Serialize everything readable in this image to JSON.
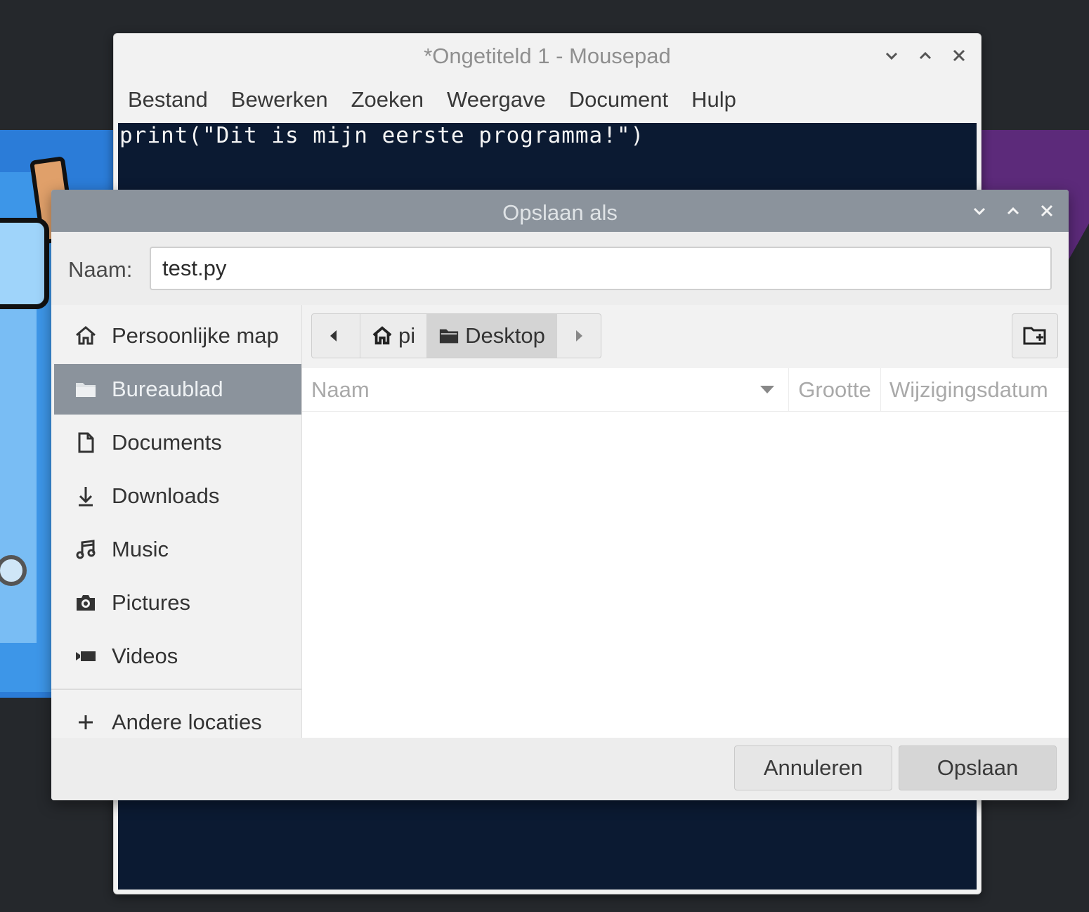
{
  "mousepad": {
    "title": "*Ongetiteld 1 - Mousepad",
    "menu": [
      "Bestand",
      "Bewerken",
      "Zoeken",
      "Weergave",
      "Document",
      "Hulp"
    ],
    "editor_text": "print(\"Dit is mijn eerste programma!\")"
  },
  "dialog": {
    "title": "Opslaan als",
    "name_label": "Naam:",
    "name_value": "test.py",
    "sidebar": [
      {
        "label": "Persoonlijke map",
        "icon": "home-icon"
      },
      {
        "label": "Bureaublad",
        "icon": "folder-icon",
        "active": true
      },
      {
        "label": "Documents",
        "icon": "document-icon"
      },
      {
        "label": "Downloads",
        "icon": "download-icon"
      },
      {
        "label": "Music",
        "icon": "music-icon"
      },
      {
        "label": "Pictures",
        "icon": "camera-icon"
      },
      {
        "label": "Videos",
        "icon": "video-icon"
      }
    ],
    "other_locations": "Andere locaties",
    "path": {
      "home": "pi",
      "current": "Desktop"
    },
    "columns": {
      "name": "Naam",
      "size": "Grootte",
      "date": "Wijzigingsdatum"
    },
    "buttons": {
      "cancel": "Annuleren",
      "save": "Opslaan"
    }
  },
  "colors": {
    "editor_bg": "#0b1a32",
    "dialog_titlebar": "#8b939c",
    "sidebar_active": "#8b939c"
  }
}
